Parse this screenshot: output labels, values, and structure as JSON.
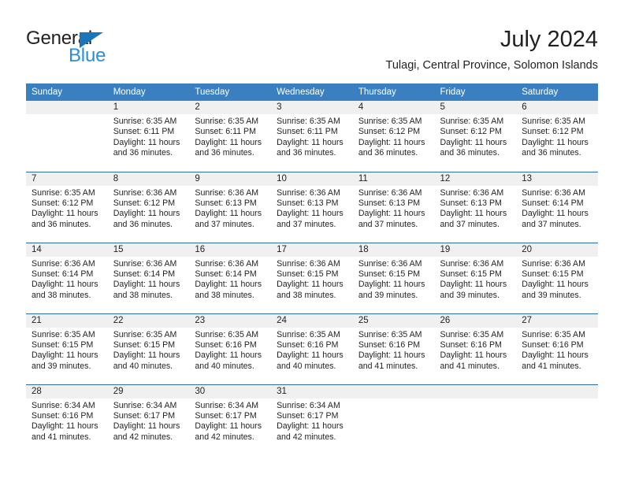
{
  "brand": {
    "word1": "General",
    "word2": "Blue",
    "triangle_color": "#1b75bb",
    "word2_color": "#2b8fd4"
  },
  "header": {
    "title": "July 2024",
    "subtitle": "Tulagi, Central Province, Solomon Islands",
    "header_bg": "#3a80c1",
    "daynum_bg": "#f0f0f0"
  },
  "weekday_headers": [
    "Sunday",
    "Monday",
    "Tuesday",
    "Wednesday",
    "Thursday",
    "Friday",
    "Saturday"
  ],
  "weeks": [
    [
      {
        "day": "",
        "sunrise": "",
        "sunset": "",
        "daylight1": "",
        "daylight2": ""
      },
      {
        "day": "1",
        "sunrise": "Sunrise: 6:35 AM",
        "sunset": "Sunset: 6:11 PM",
        "daylight1": "Daylight: 11 hours",
        "daylight2": "and 36 minutes."
      },
      {
        "day": "2",
        "sunrise": "Sunrise: 6:35 AM",
        "sunset": "Sunset: 6:11 PM",
        "daylight1": "Daylight: 11 hours",
        "daylight2": "and 36 minutes."
      },
      {
        "day": "3",
        "sunrise": "Sunrise: 6:35 AM",
        "sunset": "Sunset: 6:11 PM",
        "daylight1": "Daylight: 11 hours",
        "daylight2": "and 36 minutes."
      },
      {
        "day": "4",
        "sunrise": "Sunrise: 6:35 AM",
        "sunset": "Sunset: 6:12 PM",
        "daylight1": "Daylight: 11 hours",
        "daylight2": "and 36 minutes."
      },
      {
        "day": "5",
        "sunrise": "Sunrise: 6:35 AM",
        "sunset": "Sunset: 6:12 PM",
        "daylight1": "Daylight: 11 hours",
        "daylight2": "and 36 minutes."
      },
      {
        "day": "6",
        "sunrise": "Sunrise: 6:35 AM",
        "sunset": "Sunset: 6:12 PM",
        "daylight1": "Daylight: 11 hours",
        "daylight2": "and 36 minutes."
      }
    ],
    [
      {
        "day": "7",
        "sunrise": "Sunrise: 6:35 AM",
        "sunset": "Sunset: 6:12 PM",
        "daylight1": "Daylight: 11 hours",
        "daylight2": "and 36 minutes."
      },
      {
        "day": "8",
        "sunrise": "Sunrise: 6:36 AM",
        "sunset": "Sunset: 6:12 PM",
        "daylight1": "Daylight: 11 hours",
        "daylight2": "and 36 minutes."
      },
      {
        "day": "9",
        "sunrise": "Sunrise: 6:36 AM",
        "sunset": "Sunset: 6:13 PM",
        "daylight1": "Daylight: 11 hours",
        "daylight2": "and 37 minutes."
      },
      {
        "day": "10",
        "sunrise": "Sunrise: 6:36 AM",
        "sunset": "Sunset: 6:13 PM",
        "daylight1": "Daylight: 11 hours",
        "daylight2": "and 37 minutes."
      },
      {
        "day": "11",
        "sunrise": "Sunrise: 6:36 AM",
        "sunset": "Sunset: 6:13 PM",
        "daylight1": "Daylight: 11 hours",
        "daylight2": "and 37 minutes."
      },
      {
        "day": "12",
        "sunrise": "Sunrise: 6:36 AM",
        "sunset": "Sunset: 6:13 PM",
        "daylight1": "Daylight: 11 hours",
        "daylight2": "and 37 minutes."
      },
      {
        "day": "13",
        "sunrise": "Sunrise: 6:36 AM",
        "sunset": "Sunset: 6:14 PM",
        "daylight1": "Daylight: 11 hours",
        "daylight2": "and 37 minutes."
      }
    ],
    [
      {
        "day": "14",
        "sunrise": "Sunrise: 6:36 AM",
        "sunset": "Sunset: 6:14 PM",
        "daylight1": "Daylight: 11 hours",
        "daylight2": "and 38 minutes."
      },
      {
        "day": "15",
        "sunrise": "Sunrise: 6:36 AM",
        "sunset": "Sunset: 6:14 PM",
        "daylight1": "Daylight: 11 hours",
        "daylight2": "and 38 minutes."
      },
      {
        "day": "16",
        "sunrise": "Sunrise: 6:36 AM",
        "sunset": "Sunset: 6:14 PM",
        "daylight1": "Daylight: 11 hours",
        "daylight2": "and 38 minutes."
      },
      {
        "day": "17",
        "sunrise": "Sunrise: 6:36 AM",
        "sunset": "Sunset: 6:15 PM",
        "daylight1": "Daylight: 11 hours",
        "daylight2": "and 38 minutes."
      },
      {
        "day": "18",
        "sunrise": "Sunrise: 6:36 AM",
        "sunset": "Sunset: 6:15 PM",
        "daylight1": "Daylight: 11 hours",
        "daylight2": "and 39 minutes."
      },
      {
        "day": "19",
        "sunrise": "Sunrise: 6:36 AM",
        "sunset": "Sunset: 6:15 PM",
        "daylight1": "Daylight: 11 hours",
        "daylight2": "and 39 minutes."
      },
      {
        "day": "20",
        "sunrise": "Sunrise: 6:36 AM",
        "sunset": "Sunset: 6:15 PM",
        "daylight1": "Daylight: 11 hours",
        "daylight2": "and 39 minutes."
      }
    ],
    [
      {
        "day": "21",
        "sunrise": "Sunrise: 6:35 AM",
        "sunset": "Sunset: 6:15 PM",
        "daylight1": "Daylight: 11 hours",
        "daylight2": "and 39 minutes."
      },
      {
        "day": "22",
        "sunrise": "Sunrise: 6:35 AM",
        "sunset": "Sunset: 6:15 PM",
        "daylight1": "Daylight: 11 hours",
        "daylight2": "and 40 minutes."
      },
      {
        "day": "23",
        "sunrise": "Sunrise: 6:35 AM",
        "sunset": "Sunset: 6:16 PM",
        "daylight1": "Daylight: 11 hours",
        "daylight2": "and 40 minutes."
      },
      {
        "day": "24",
        "sunrise": "Sunrise: 6:35 AM",
        "sunset": "Sunset: 6:16 PM",
        "daylight1": "Daylight: 11 hours",
        "daylight2": "and 40 minutes."
      },
      {
        "day": "25",
        "sunrise": "Sunrise: 6:35 AM",
        "sunset": "Sunset: 6:16 PM",
        "daylight1": "Daylight: 11 hours",
        "daylight2": "and 41 minutes."
      },
      {
        "day": "26",
        "sunrise": "Sunrise: 6:35 AM",
        "sunset": "Sunset: 6:16 PM",
        "daylight1": "Daylight: 11 hours",
        "daylight2": "and 41 minutes."
      },
      {
        "day": "27",
        "sunrise": "Sunrise: 6:35 AM",
        "sunset": "Sunset: 6:16 PM",
        "daylight1": "Daylight: 11 hours",
        "daylight2": "and 41 minutes."
      }
    ],
    [
      {
        "day": "28",
        "sunrise": "Sunrise: 6:34 AM",
        "sunset": "Sunset: 6:16 PM",
        "daylight1": "Daylight: 11 hours",
        "daylight2": "and 41 minutes."
      },
      {
        "day": "29",
        "sunrise": "Sunrise: 6:34 AM",
        "sunset": "Sunset: 6:17 PM",
        "daylight1": "Daylight: 11 hours",
        "daylight2": "and 42 minutes."
      },
      {
        "day": "30",
        "sunrise": "Sunrise: 6:34 AM",
        "sunset": "Sunset: 6:17 PM",
        "daylight1": "Daylight: 11 hours",
        "daylight2": "and 42 minutes."
      },
      {
        "day": "31",
        "sunrise": "Sunrise: 6:34 AM",
        "sunset": "Sunset: 6:17 PM",
        "daylight1": "Daylight: 11 hours",
        "daylight2": "and 42 minutes."
      },
      {
        "day": "",
        "sunrise": "",
        "sunset": "",
        "daylight1": "",
        "daylight2": ""
      },
      {
        "day": "",
        "sunrise": "",
        "sunset": "",
        "daylight1": "",
        "daylight2": ""
      },
      {
        "day": "",
        "sunrise": "",
        "sunset": "",
        "daylight1": "",
        "daylight2": ""
      }
    ]
  ]
}
